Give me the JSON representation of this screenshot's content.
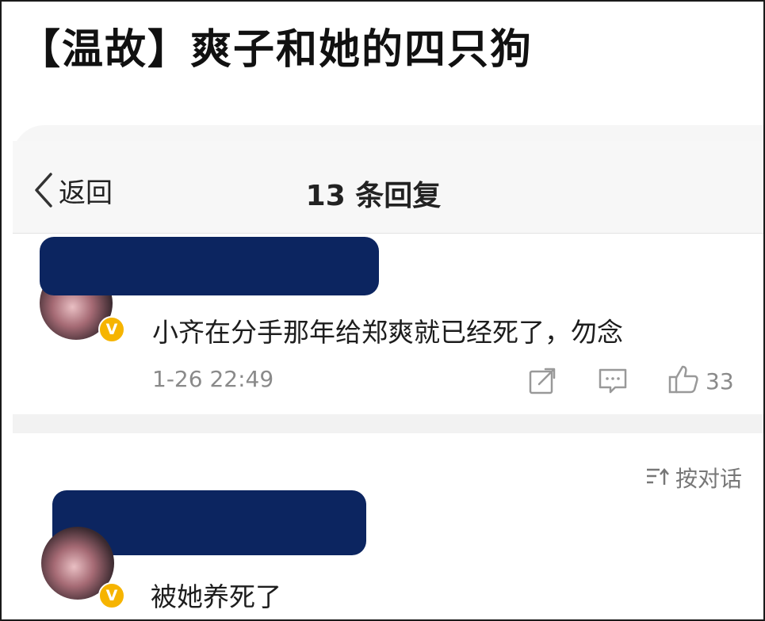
{
  "headline": "【温故】爽子和她的四只狗",
  "nav": {
    "back_label": "返回",
    "title": "13 条回复"
  },
  "comments": [
    {
      "text": "小齐在分手那年给郑爽就已经死了，勿念",
      "time": "1-26 22:49",
      "badge": "V",
      "likes": "33"
    },
    {
      "text": "被她养死了",
      "badge": "V"
    }
  ],
  "sort": {
    "label": "按对话",
    "icon": "sort-icon"
  },
  "icons": {
    "back": "chevron-left-icon",
    "share": "share-icon",
    "comment": "comment-icon",
    "like": "thumbs-up-icon"
  },
  "colors": {
    "badge": "#f6b400",
    "redaction": "#0c2560"
  }
}
